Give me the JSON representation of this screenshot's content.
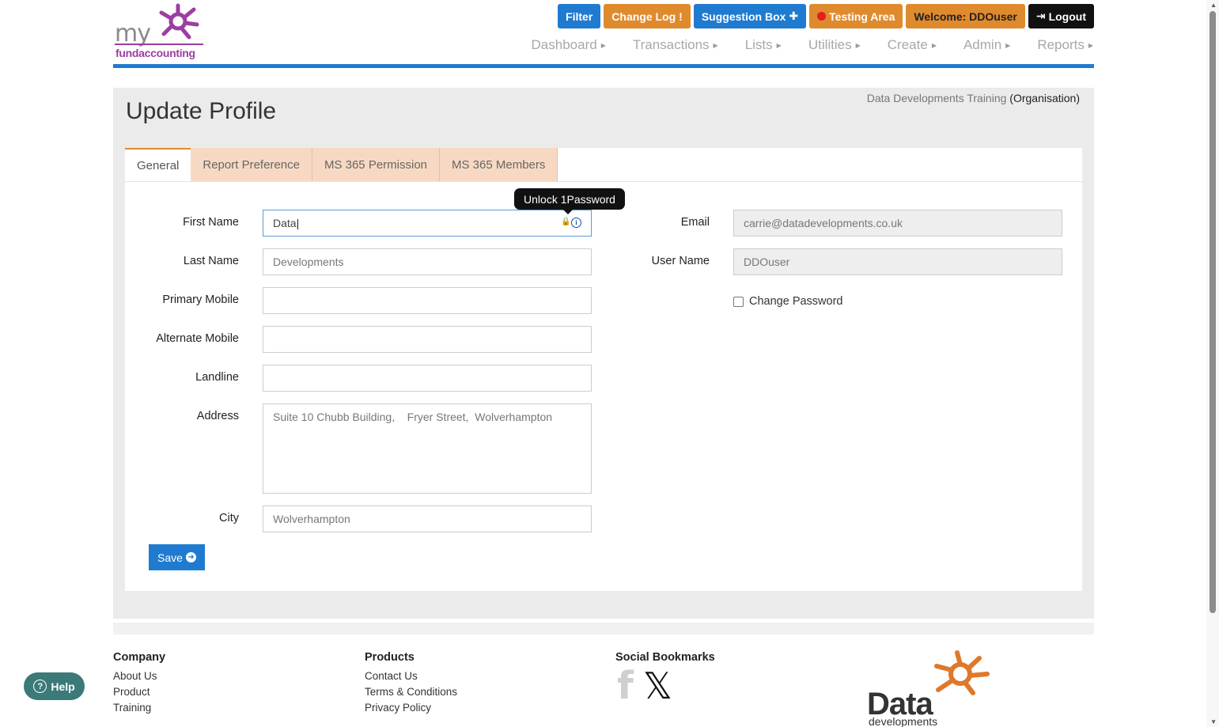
{
  "logo": {
    "my": "my",
    "name": "fundaccounting"
  },
  "topbar": {
    "filter": "Filter",
    "change_log": "Change Log",
    "change_log_icon": "!",
    "suggestion_box": "Suggestion Box",
    "suggestion_icon": "✚",
    "testing_area": "Testing Area",
    "welcome": "Welcome:  DDOuser",
    "logout": "Logout",
    "logout_icon": "⇥"
  },
  "nav": [
    "Dashboard",
    "Transactions",
    "Lists",
    "Utilities",
    "Create",
    "Admin",
    "Reports"
  ],
  "page": {
    "title": "Update Profile",
    "org_name": "Data Developments Training",
    "org_suffix": "(Organisation)"
  },
  "tabs": [
    "General",
    "Report Preference",
    "MS 365 Permission",
    "MS 365 Members"
  ],
  "tooltip": "Unlock 1Password",
  "form": {
    "first_name_label": "First Name",
    "first_name_value": "Data",
    "last_name_label": "Last Name",
    "last_name_value": "Developments",
    "primary_mobile_label": "Primary Mobile",
    "primary_mobile_value": "",
    "alternate_mobile_label": "Alternate Mobile",
    "alternate_mobile_value": "",
    "landline_label": "Landline",
    "landline_value": "",
    "address_label": "Address",
    "address_value": "Suite 10 Chubb Building,    Fryer Street,  Wolverhampton",
    "city_label": "City",
    "city_value": "Wolverhampton",
    "email_label": "Email",
    "email_value": "carrie@datadevelopments.co.uk",
    "username_label": "User Name",
    "username_value": "DDOuser",
    "change_password_label": "Change Password",
    "save_label": "Save"
  },
  "footer": {
    "company_heading": "Company",
    "company_links": [
      "About Us",
      "Product",
      "Training"
    ],
    "products_heading": "Products",
    "products_links": [
      "Contact Us",
      "Terms & Conditions",
      "Privacy Policy"
    ],
    "social_heading": "Social Bookmarks",
    "data_logo_word": "Data",
    "data_logo_sub": "developments"
  },
  "help": "Help",
  "colors": {
    "primary": "#1f7bd0",
    "orange": "#e08a2e",
    "tab_inactive": "#f7d9c3",
    "help": "#3b7a78",
    "brand_purple": "#9b3fa0"
  }
}
